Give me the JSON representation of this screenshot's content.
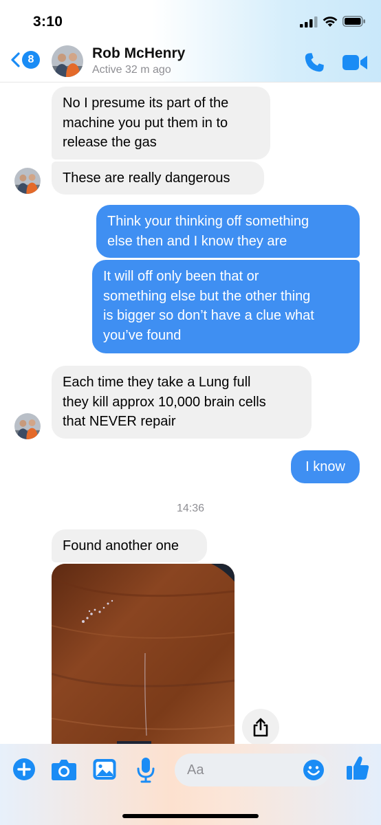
{
  "status_bar": {
    "time": "3:10"
  },
  "header": {
    "back_badge": "8",
    "contact_name": "Rob McHenry",
    "contact_status": "Active 32 m ago"
  },
  "messages": [
    {
      "side": "in",
      "lines": [
        "No I presume its part of the",
        "machine you put them in to",
        "release the gas"
      ]
    },
    {
      "side": "in",
      "lines": [
        "These are really dangerous"
      ]
    },
    {
      "side": "out",
      "lines": [
        "Think your thinking off something",
        "else then and I know they are"
      ]
    },
    {
      "side": "out",
      "lines": [
        "It will off only been that or",
        "something else but the other thing",
        "is bigger so don’t have a clue what",
        "you’ve found"
      ]
    },
    {
      "side": "in",
      "lines": [
        "Each time they take a Lung full",
        "they kill approx 10,000 brain cells",
        "that NEVER repair"
      ]
    },
    {
      "side": "out",
      "lines": [
        "I know"
      ]
    },
    {
      "side": "in",
      "lines": [
        "Found another one"
      ]
    }
  ],
  "timestamp": "14:36",
  "composer": {
    "placeholder": "Aa"
  },
  "colors": {
    "accent": "#1a8cf5",
    "outgoing_bubble": "#3f8ff2",
    "incoming_bubble": "#f0f0f0"
  }
}
